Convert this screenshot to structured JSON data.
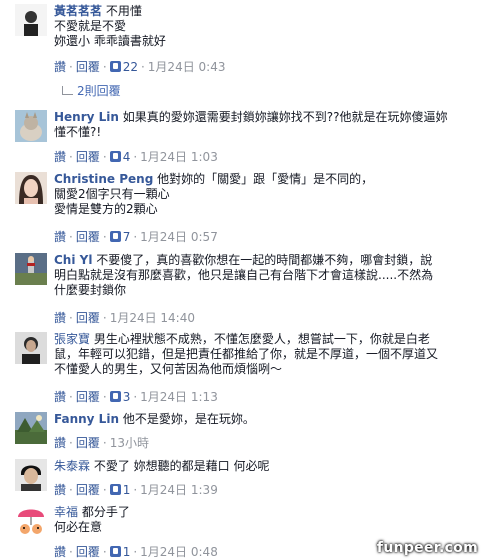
{
  "colors": {
    "link": "#365899",
    "meta": "#90949c",
    "like": "#4267b2"
  },
  "comments": [
    {
      "name": "黃茗茗茗",
      "lines": [
        "不用懂",
        "不愛就是不愛",
        "妳還小 乖乖讀書就好"
      ],
      "like_label": "讚",
      "reply_label": "回覆",
      "likes": "22",
      "time": "1月24日 0:43",
      "replies_label": "2則回覆",
      "avatar_icon": "user-avatar-icon"
    },
    {
      "name": "Henry Lin",
      "lines": [
        "如果真的愛妳還需要封鎖妳讓妳找不到??他就是在玩妳傻逼妳",
        "懂不懂?!"
      ],
      "like_label": "讚",
      "reply_label": "回覆",
      "likes": "4",
      "time": "1月24日 1:03",
      "avatar_icon": "cat-avatar-icon"
    },
    {
      "name": "Christine Peng",
      "lines": [
        "他對妳的「關愛」跟「愛情」是不同的，",
        "關愛2個字只有一顆心",
        "愛情是雙方的2顆心"
      ],
      "like_label": "讚",
      "reply_label": "回覆",
      "likes": "7",
      "time": "1月24日 0:57",
      "avatar_icon": "girl-avatar-icon"
    },
    {
      "name": "Chi Yl",
      "lines": [
        "不要傻了，真的喜歡你想在一起的時間都嫌不夠，哪會封鎖，說",
        "明白點就是沒有那麼喜歡，他只是讓自己有台階下才會這樣說.....不然為",
        "什麼要封鎖你"
      ],
      "like_label": "讚",
      "reply_label": "回覆",
      "time": "1月24日 14:40",
      "avatar_icon": "baseball-avatar-icon"
    },
    {
      "name": "張家寶",
      "lines": [
        "男生心裡狀態不成熟，不懂怎麼愛人，想嘗試一下，你就是白老",
        "鼠，年輕可以犯錯，但是把責任都推給了你，就是不厚道，一個不厚道又",
        "不懂愛人的男生，又何苦因為他而煩惱咧～"
      ],
      "like_label": "讚",
      "reply_label": "回覆",
      "likes": "3",
      "time": "1月24日 1:13",
      "avatar_icon": "man-avatar-icon"
    },
    {
      "name": "Fanny Lin",
      "lines": [
        "他不是愛妳，是在玩妳。"
      ],
      "like_label": "讚",
      "reply_label": "回覆",
      "time": "13小時",
      "avatar_icon": "landscape-avatar-icon"
    },
    {
      "name": "朱泰霖",
      "lines": [
        "不愛了 妳想聽的都是藉口 何必呢"
      ],
      "like_label": "讚",
      "reply_label": "回覆",
      "likes": "1",
      "time": "1月24日 1:39",
      "avatar_icon": "boy-avatar-icon"
    },
    {
      "name": "幸福",
      "lines": [
        "都分手了",
        "何必在意"
      ],
      "like_label": "讚",
      "reply_label": "回覆",
      "likes": "1",
      "time": "1月24日 0:48",
      "avatar_icon": "cartoon-avatar-icon"
    }
  ],
  "watermark": "funpeer.com"
}
